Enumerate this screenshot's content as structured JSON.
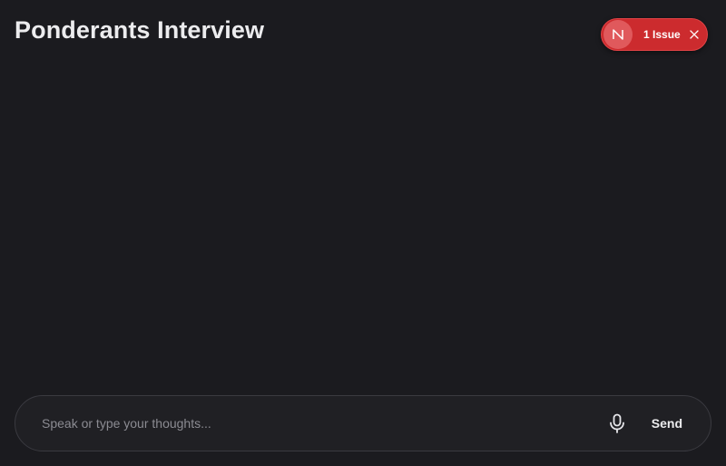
{
  "header": {
    "title": "Ponderants Interview"
  },
  "issue_badge": {
    "logo_letter": "N",
    "label": "1 Issue",
    "logo_icon": "next-logo-icon",
    "close_icon": "close-icon",
    "color": "#cc2b2e"
  },
  "composer": {
    "placeholder": "Speak or type your thoughts...",
    "value": "",
    "mic_icon": "microphone-icon",
    "send_label": "Send"
  },
  "theme": {
    "background": "#1b1b1f",
    "text": "#ececee"
  }
}
